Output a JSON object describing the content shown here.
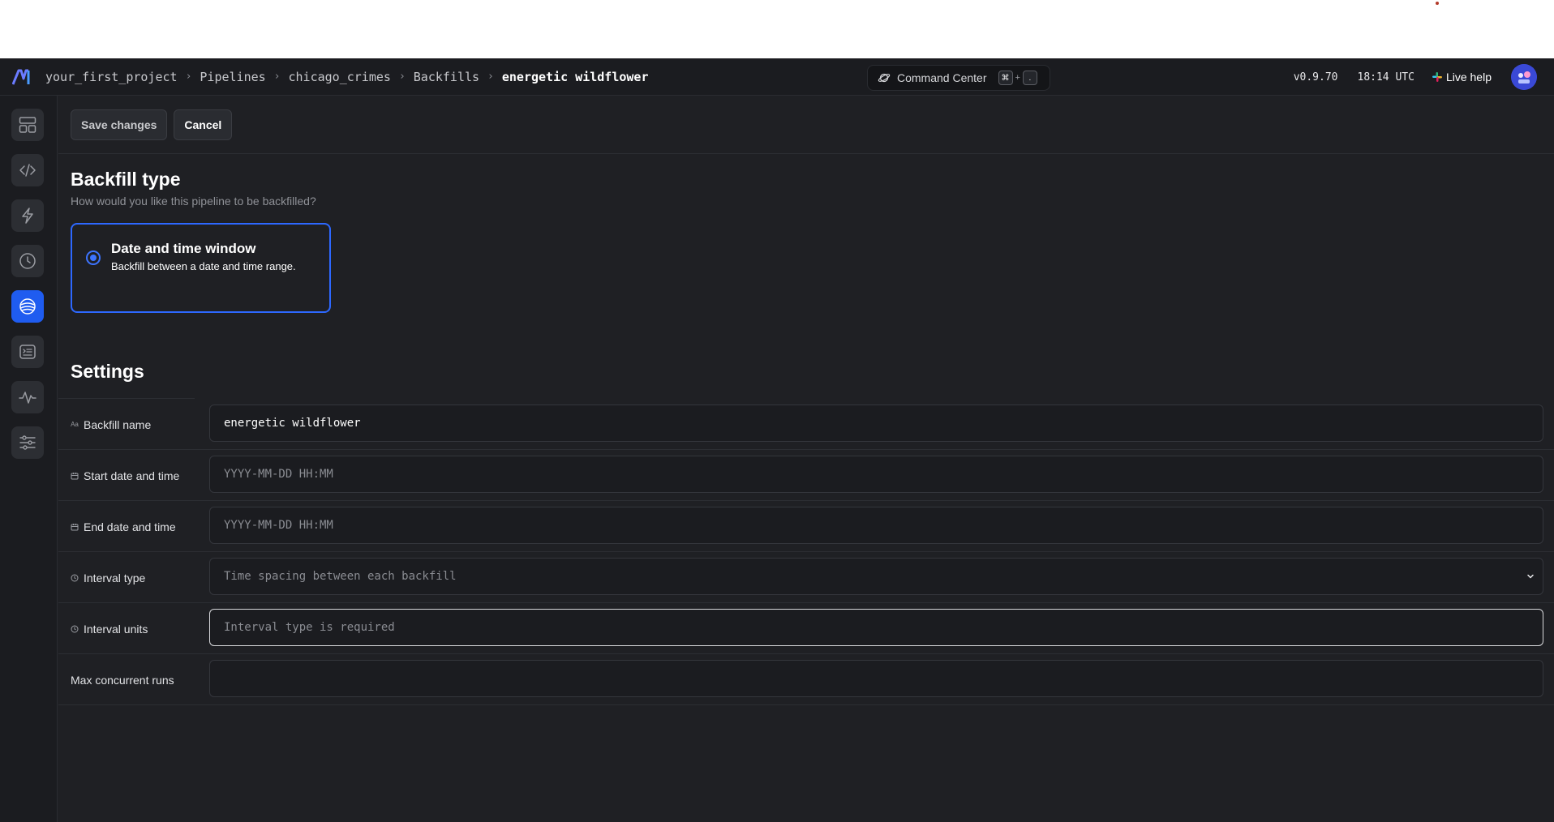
{
  "breadcrumbs": [
    "your_first_project",
    "Pipelines",
    "chicago_crimes",
    "Backfills"
  ],
  "breadcrumb_current": "energetic wildflower",
  "command_center": {
    "label": "Command Center",
    "key1": "⌘",
    "plus": "+",
    "key2": "."
  },
  "version": "v0.9.70",
  "time": "18:14 UTC",
  "live_help": "Live help",
  "toolbar": {
    "save_label": "Save changes",
    "cancel_label": "Cancel"
  },
  "backfill_type": {
    "title": "Backfill type",
    "subtitle": "How would you like this pipeline to be backfilled?",
    "option_title": "Date and time window",
    "option_desc": "Backfill between a date and time range."
  },
  "settings": {
    "title": "Settings",
    "backfill_name": {
      "label": "Backfill name",
      "icon": "Aa",
      "value": "energetic wildflower"
    },
    "start": {
      "label": "Start date and time",
      "placeholder": "YYYY-MM-DD HH:MM"
    },
    "end": {
      "label": "End date and time",
      "placeholder": "YYYY-MM-DD HH:MM"
    },
    "interval_type": {
      "label": "Interval type",
      "placeholder": "Time spacing between each backfill"
    },
    "interval_units": {
      "label": "Interval units",
      "placeholder": "Interval type is required"
    },
    "max_runs": {
      "label": "Max concurrent runs",
      "value": ""
    }
  },
  "colors": {
    "accent": "#1f5cf0",
    "background": "#1f2024",
    "header": "#1b1c20"
  },
  "sidebar_icons": [
    "layout-icon",
    "code-icon",
    "lightning-icon",
    "clock-icon",
    "backfill-globe-icon",
    "terminal-icon",
    "pulse-icon",
    "sliders-icon"
  ]
}
